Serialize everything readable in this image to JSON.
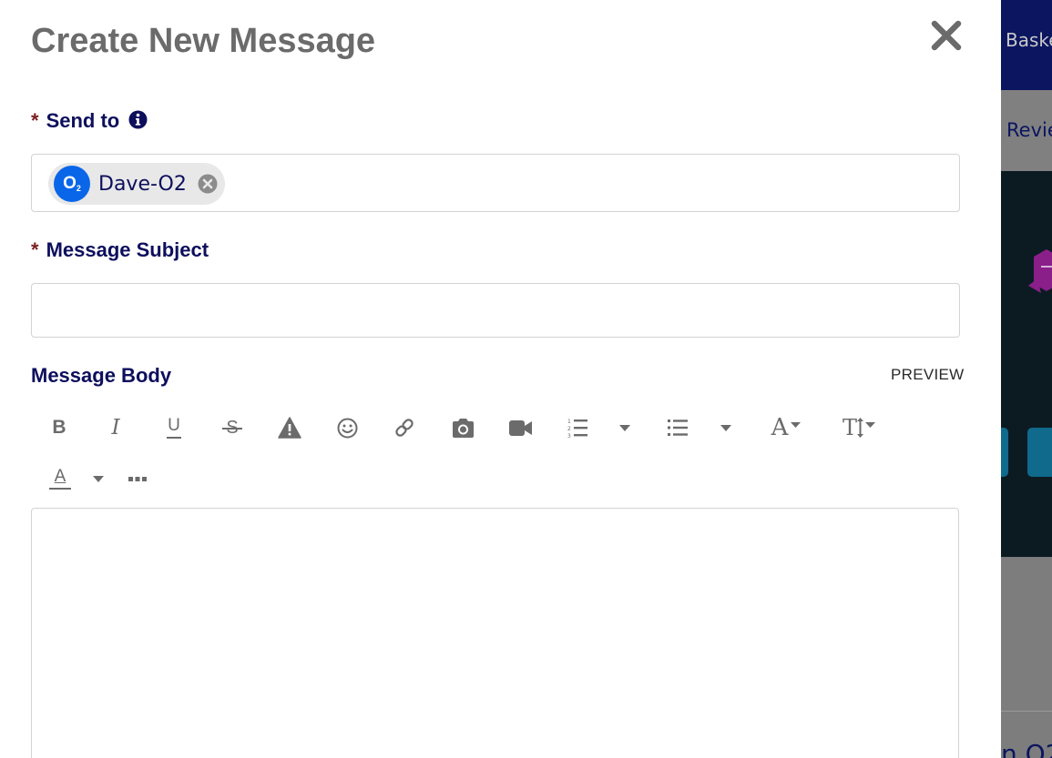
{
  "modal": {
    "title": "Create New Message"
  },
  "send_to": {
    "required_marker": "*",
    "label": "Send to",
    "recipients": [
      {
        "avatar_text": "O",
        "avatar_subscript": "2",
        "name": "Dave-O2"
      }
    ]
  },
  "subject": {
    "required_marker": "*",
    "label": "Message Subject",
    "value": "",
    "placeholder": ""
  },
  "body": {
    "label": "Message Body",
    "preview_label": "PREVIEW",
    "value": ""
  },
  "toolbar": {
    "bold_glyph": "B",
    "italic_glyph": "I",
    "underline_glyph": "U",
    "strike_glyph": "S",
    "font_glyph": "A",
    "text_size_glyph": "T",
    "text_color_glyph": "A"
  },
  "background_page": {
    "top_nav_text": "Baske",
    "tab_text": "Revie",
    "bottom_text": "n O2"
  },
  "colors": {
    "title_gray": "#6b6b6b",
    "label_navy": "#0d0f5c",
    "required_red": "#7a1f1f",
    "avatar_blue": "#0a66e8",
    "icon_gray": "#6b6b6b"
  }
}
